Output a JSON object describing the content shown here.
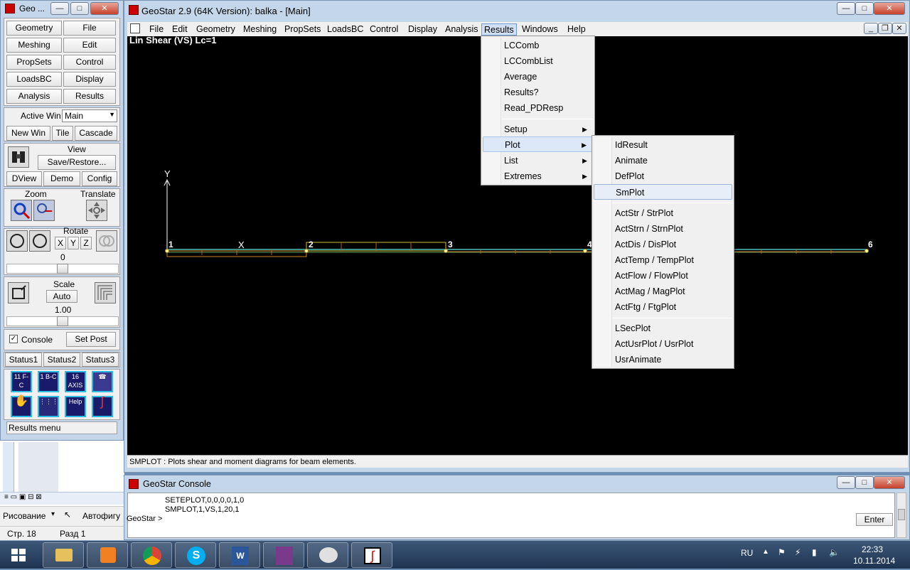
{
  "tool_window": {
    "title": "Geo ...",
    "menu_buttons": [
      {
        "label": "Geometry"
      },
      {
        "label": "File"
      },
      {
        "label": "Meshing"
      },
      {
        "label": "Edit"
      },
      {
        "label": "PropSets"
      },
      {
        "label": "Control"
      },
      {
        "label": "LoadsBC"
      },
      {
        "label": "Display"
      },
      {
        "label": "Analysis"
      },
      {
        "label": "Results"
      }
    ],
    "active_win_label": "Active Win",
    "active_win_value": "Main",
    "new_win": "New Win",
    "tile": "Tile",
    "cascade": "Cascade",
    "view_label": "View",
    "save_restore": "Save/Restore...",
    "dview": "DView",
    "demo": "Demo",
    "config": "Config",
    "zoom_label": "Zoom",
    "translate_label": "Translate",
    "rotate_label": "Rotate",
    "axis_x": "X",
    "axis_y": "Y",
    "axis_z": "Z",
    "rotate_value": "0",
    "rotate_level": 0.5,
    "scale_label": "Scale",
    "scale_auto": "Auto",
    "scale_value": "1.00",
    "scale_level": 0.5,
    "console_label": "Console",
    "console_checked": true,
    "set_post": "Set Post",
    "status_buttons": [
      "Status1",
      "Status2",
      "Status3"
    ],
    "icon_labels": [
      "11 F-C",
      "1 B-C",
      "16 AXIS"
    ],
    "help_icon_label": "Help",
    "footer_text": "Results menu"
  },
  "main_window": {
    "title": "GeoStar 2.9 (64K Version): balka - [Main]",
    "menus": [
      "File",
      "Edit",
      "Geometry",
      "Meshing",
      "PropSets",
      "LoadsBC",
      "Control",
      "Display",
      "Analysis",
      "Results",
      "Windows",
      "Help"
    ],
    "active_menu": "Results",
    "plot_title": "Lin Shear (VS) Lc=1",
    "axis_y_label": "Y",
    "axis_x_label": "X",
    "node_labels": [
      "1",
      "2",
      "3",
      "4",
      "6"
    ],
    "status_text": "SMPLOT : Plots shear and moment diagrams for beam elements."
  },
  "results_menu": {
    "items": [
      "LCComb",
      "LCCombList",
      "Average",
      "Results?",
      "Read_PDResp"
    ],
    "submenus": [
      "Setup",
      "Plot",
      "List",
      "Extremes"
    ],
    "highlighted": "Plot"
  },
  "plot_submenu": {
    "group1": [
      "IdResult",
      "Animate",
      "DefPlot",
      "SmPlot"
    ],
    "group2": [
      "ActStr / StrPlot",
      "ActStrn / StrnPlot",
      "ActDis / DisPlot",
      "ActTemp / TempPlot",
      "ActFlow / FlowPlot",
      "ActMag / MagPlot",
      "ActFtg / FtgPlot"
    ],
    "group3": [
      "LSecPlot",
      "ActUsrPlot / UsrPlot",
      "UsrAnimate"
    ],
    "highlighted": "SmPlot"
  },
  "console": {
    "title": "GeoStar Console",
    "lines": [
      "SETEPLOT,0,0,0,0,1,0",
      "SMPLOT,1,VS,1,20,1"
    ],
    "prompt": "GeoStar >",
    "enter_label": "Enter"
  },
  "word_background": {
    "drawing_menu": "Рисование",
    "autoshapes": "Автофигу",
    "page": "Стр. 18",
    "section": "Разд 1"
  },
  "taskbar": {
    "apps": [
      "file-explorer-icon",
      "media-player-icon",
      "chrome-icon",
      "skype-icon",
      "word-icon",
      "winrar-icon",
      "paint-icon",
      "geostar-icon"
    ],
    "language": "RU",
    "time": "22:33",
    "date": "10.11.2014"
  }
}
